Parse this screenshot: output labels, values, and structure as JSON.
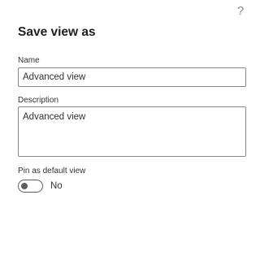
{
  "dialog": {
    "title": "Save view as",
    "help_icon": "question-mark-icon",
    "help_glyph": "?"
  },
  "fields": {
    "name": {
      "label": "Name",
      "value": "Advanced view"
    },
    "description": {
      "label": "Description",
      "value": "Advanced view"
    },
    "pin_default": {
      "label": "Pin as default view",
      "checked": false,
      "state_text": "No"
    }
  },
  "colors": {
    "border": "#8a8886",
    "text": "#323130",
    "toggle_off": "#605e5c"
  }
}
